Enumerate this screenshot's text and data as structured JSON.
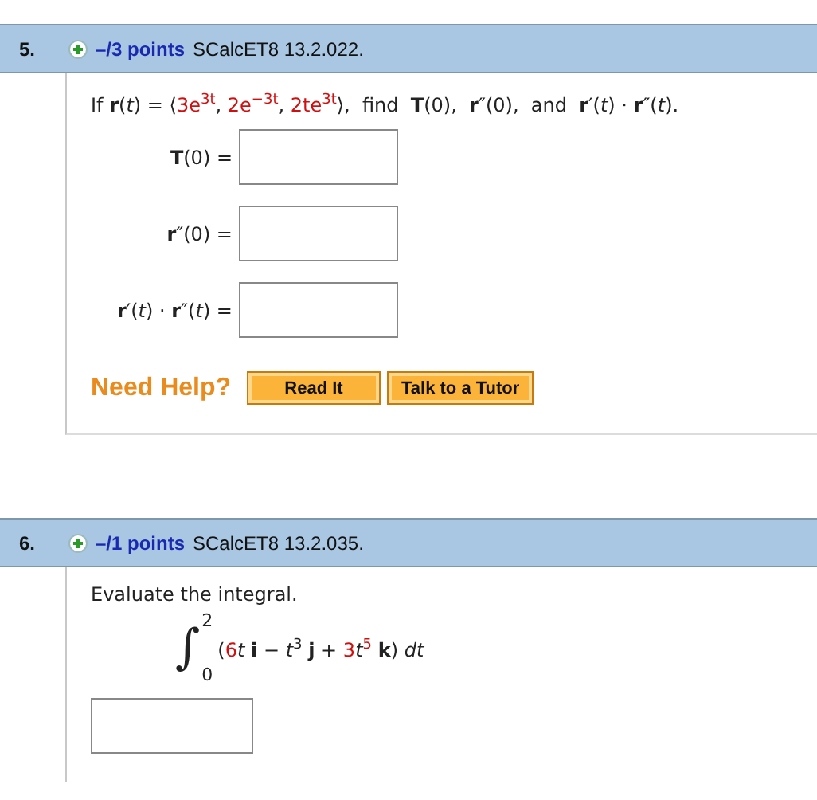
{
  "questions": [
    {
      "number": "5.",
      "points": "–/3 points",
      "source": "SCalcET8 13.2.022.",
      "prompt": [
        {
          "kind": "text",
          "text": "If **r**(*t*) = ⟨"
        },
        {
          "kind": "value",
          "text": "3e$^{3t}$"
        },
        {
          "kind": "text",
          "text": ", "
        },
        {
          "kind": "value",
          "text": "2e$^{−3t}$"
        },
        {
          "kind": "text",
          "text": ", "
        },
        {
          "kind": "value",
          "text": "2te$^{3t}$"
        },
        {
          "kind": "text",
          "text": "⟩,  find  **T**(0),  **r**″(0),  and  **r**′(*t*) · **r**″(*t*)."
        }
      ],
      "answers": [
        {
          "kind": "labeled",
          "label": "**T**(0) ="
        },
        {
          "kind": "labeled",
          "label": "**r**″(0) ="
        },
        {
          "kind": "labeled",
          "label": "**r**′(*t*) · **r**″(*t*) ="
        }
      ],
      "help": {
        "title": "Need Help?",
        "buttons": [
          "Read It",
          "Talk to a Tutor"
        ]
      }
    },
    {
      "number": "6.",
      "points": "–/1 points",
      "source": "SCalcET8 13.2.035.",
      "intro": "Evaluate the integral.",
      "integral": {
        "sign": "∫",
        "upper": "2",
        "lower": "0",
        "integrand": [
          {
            "kind": "text",
            "text": "("
          },
          {
            "kind": "value",
            "text": "6"
          },
          {
            "kind": "text",
            "text": "*t* **i** − *t*$^{3}$ **j** + "
          },
          {
            "kind": "value",
            "text": "3"
          },
          {
            "kind": "text",
            "text": "*t*"
          },
          {
            "kind": "value",
            "text": "$^{5}$"
          },
          {
            "kind": "text",
            "text": " **k**) *dt*"
          }
        ]
      },
      "answers": [
        {
          "kind": "blank"
        }
      ]
    }
  ]
}
